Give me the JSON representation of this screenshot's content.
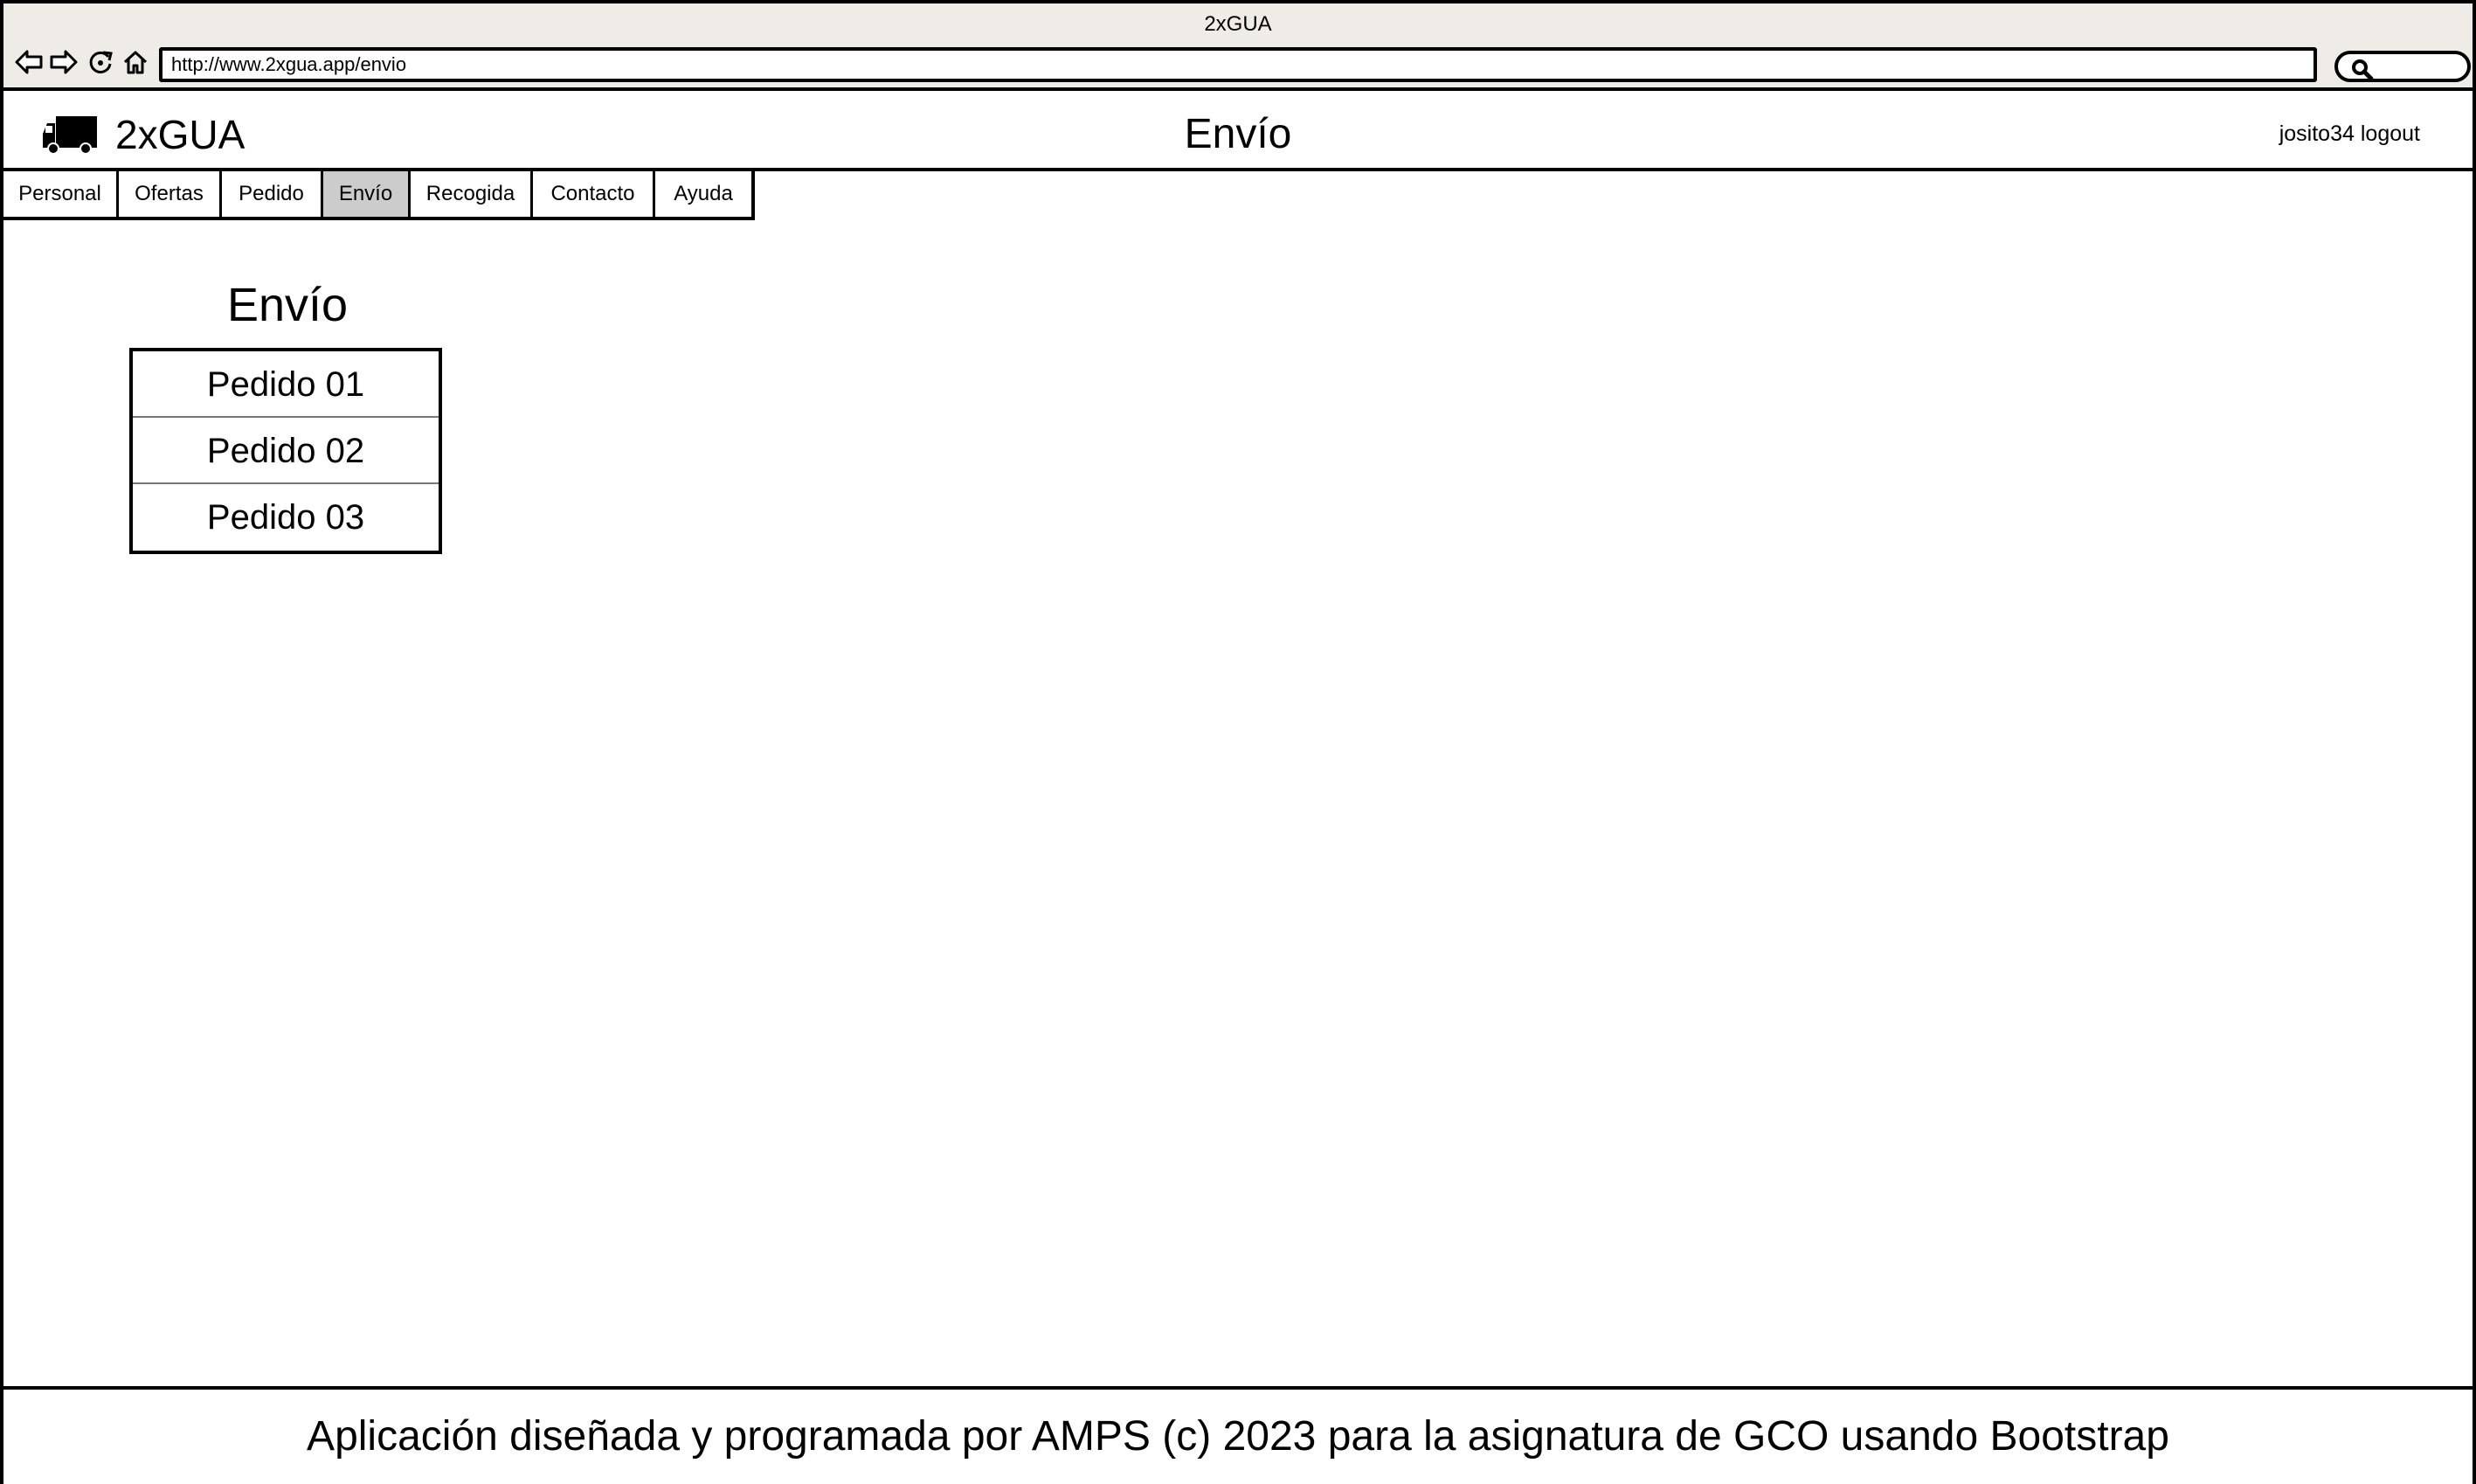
{
  "browser": {
    "window_title": "2xGUA",
    "url": "http://www.2xgua.app/envio",
    "icons": [
      "back-arrow-icon",
      "forward-arrow-icon",
      "reload-icon",
      "home-icon",
      "search-icon"
    ]
  },
  "header": {
    "logo_icon": "truck-icon",
    "brand": "2xGUA",
    "title": "Envío",
    "username": "josito34",
    "logout": "logout"
  },
  "tabs": [
    {
      "label": "Personal",
      "active": false
    },
    {
      "label": "Ofertas",
      "active": false
    },
    {
      "label": "Pedido",
      "active": false
    },
    {
      "label": "Envío",
      "active": true
    },
    {
      "label": "Recogida",
      "active": false
    },
    {
      "label": "Contacto",
      "active": false
    },
    {
      "label": "Ayuda",
      "active": false
    }
  ],
  "main": {
    "section_title": "Envío",
    "orders": [
      "Pedido 01",
      "Pedido 02",
      "Pedido 03"
    ]
  },
  "footer": {
    "text": "Aplicación diseñada y programada por AMPS (c) 2023 para la asignatura de GCO usando Bootstrap"
  },
  "colors": {
    "chrome_bg": "#efebe6",
    "active_tab_bg": "#cccccc",
    "border": "#000000"
  }
}
